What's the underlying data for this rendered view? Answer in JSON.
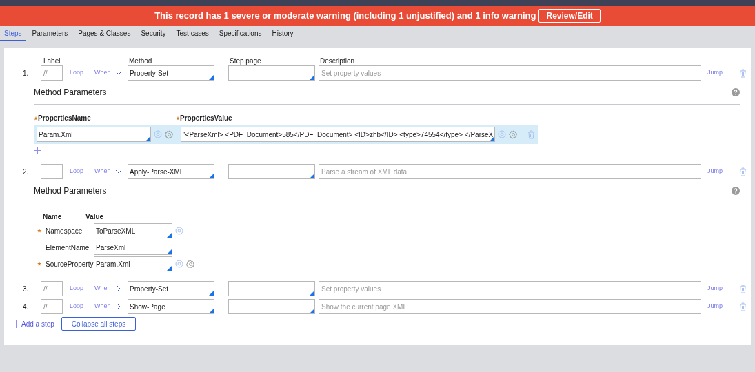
{
  "banner": {
    "message": "This record has 1 severe or moderate warning (including 1 unjustified) and 1 info warning",
    "button": "Review/Edit"
  },
  "tabs": [
    {
      "label": "Steps",
      "selected": true
    },
    {
      "label": "Parameters",
      "selected": false
    },
    {
      "label": "Pages & Classes",
      "selected": false
    },
    {
      "label": "Security",
      "selected": false
    },
    {
      "label": "Test cases",
      "selected": false
    },
    {
      "label": "Specifications",
      "selected": false
    },
    {
      "label": "History",
      "selected": false
    }
  ],
  "columns": {
    "label": "Label",
    "method": "Method",
    "step_page": "Step page",
    "description": "Description"
  },
  "steps": [
    {
      "number": "1.",
      "label": "//",
      "loop": "Loop",
      "when": "When",
      "expanded": true,
      "method": "Property-Set",
      "description_placeholder": "Set property values",
      "jump": "Jump",
      "parameters": {
        "kind": "properties",
        "title": "Method Parameters",
        "name_header": "PropertiesName",
        "value_header": "PropertiesValue",
        "rows": [
          {
            "name": "Param.Xml",
            "value": "\"<ParseXml> <PDF_Document>585</PDF_Document> <ID>zhb</ID> <type>74554</type> </ParseX",
            "selected": true
          }
        ]
      }
    },
    {
      "number": "2.",
      "loop": "Loop",
      "when": "When",
      "expanded": true,
      "method": "Apply-Parse-XML",
      "description_placeholder": "Parse a stream of XML data",
      "jump": "Jump",
      "parameters": {
        "kind": "named",
        "title": "Method Parameters",
        "name_header": "Name",
        "value_header": "Value",
        "rows": [
          {
            "name": "Namespace",
            "required": true,
            "value": "ToParseXML",
            "kind": "picker"
          },
          {
            "name": "ElementName",
            "required": false,
            "value": "ParseXml",
            "kind": "plain"
          },
          {
            "name": "SourceProperty",
            "required": true,
            "value": "Param.Xml",
            "kind": "picker-settings"
          }
        ]
      }
    },
    {
      "number": "3.",
      "label": "//",
      "loop": "Loop",
      "when": "When",
      "expanded": false,
      "method": "Property-Set",
      "description_placeholder": "Set property values",
      "jump": "Jump"
    },
    {
      "number": "4.",
      "label": "//",
      "loop": "Loop",
      "when": "When",
      "expanded": false,
      "method": "Show-Page",
      "description_placeholder": "Show the current page XML",
      "jump": "Jump"
    }
  ],
  "add_step": "Add a step",
  "collapse_button": "Collapse all steps"
}
